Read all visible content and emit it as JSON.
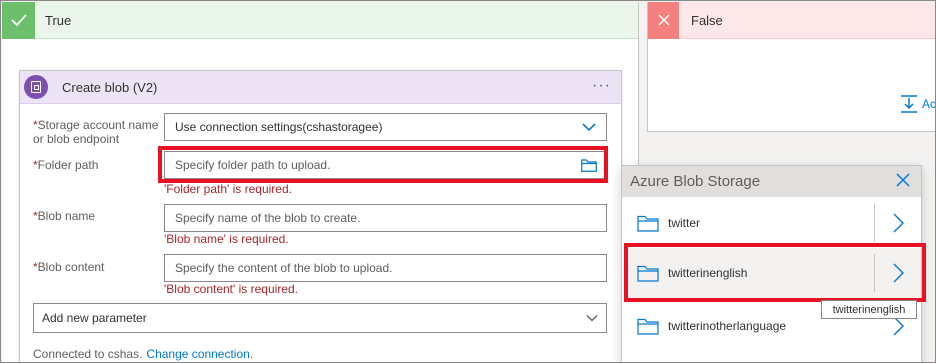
{
  "true_branch": {
    "label": "True"
  },
  "false_branch": {
    "label": "False",
    "add_action_label": "Ac"
  },
  "card": {
    "title": "Create blob (V2)",
    "menu": "···",
    "fields": {
      "storage": {
        "label_line1": "Storage account name",
        "label_line2": "or blob endpoint",
        "value": "Use connection settings(cshastoragee)"
      },
      "folder": {
        "label": "Folder path",
        "placeholder": "Specify folder path to upload.",
        "error": "'Folder path' is required."
      },
      "blob_name": {
        "label": "Blob name",
        "placeholder": "Specify name of the blob to create.",
        "error": "'Blob name' is required."
      },
      "blob_content": {
        "label": "Blob content",
        "placeholder": "Specify the content of the blob to upload.",
        "error": "'Blob content' is required."
      }
    },
    "required_mark": "*",
    "add_param": "Add new parameter",
    "connected_text": "Connected to cshas.",
    "change_connection": "Change connection."
  },
  "popup": {
    "title": "Azure Blob Storage",
    "items": [
      {
        "name": "twitter"
      },
      {
        "name": "twitterinenglish"
      },
      {
        "name": "twitterinotherlanguage"
      }
    ]
  },
  "tooltip": "twitterinenglish",
  "colors": {
    "accent": "#0078d4",
    "error": "#a4262c",
    "highlight": "#e81123",
    "true_green": "#6cc06c",
    "false_red": "#f3807f",
    "card_purple": "#7a4fb0"
  },
  "icons": [
    "checkmark-icon",
    "close-icon",
    "add-action-icon",
    "blob-storage-icon",
    "chevron-down-icon",
    "folder-icon",
    "chevron-right-icon"
  ]
}
